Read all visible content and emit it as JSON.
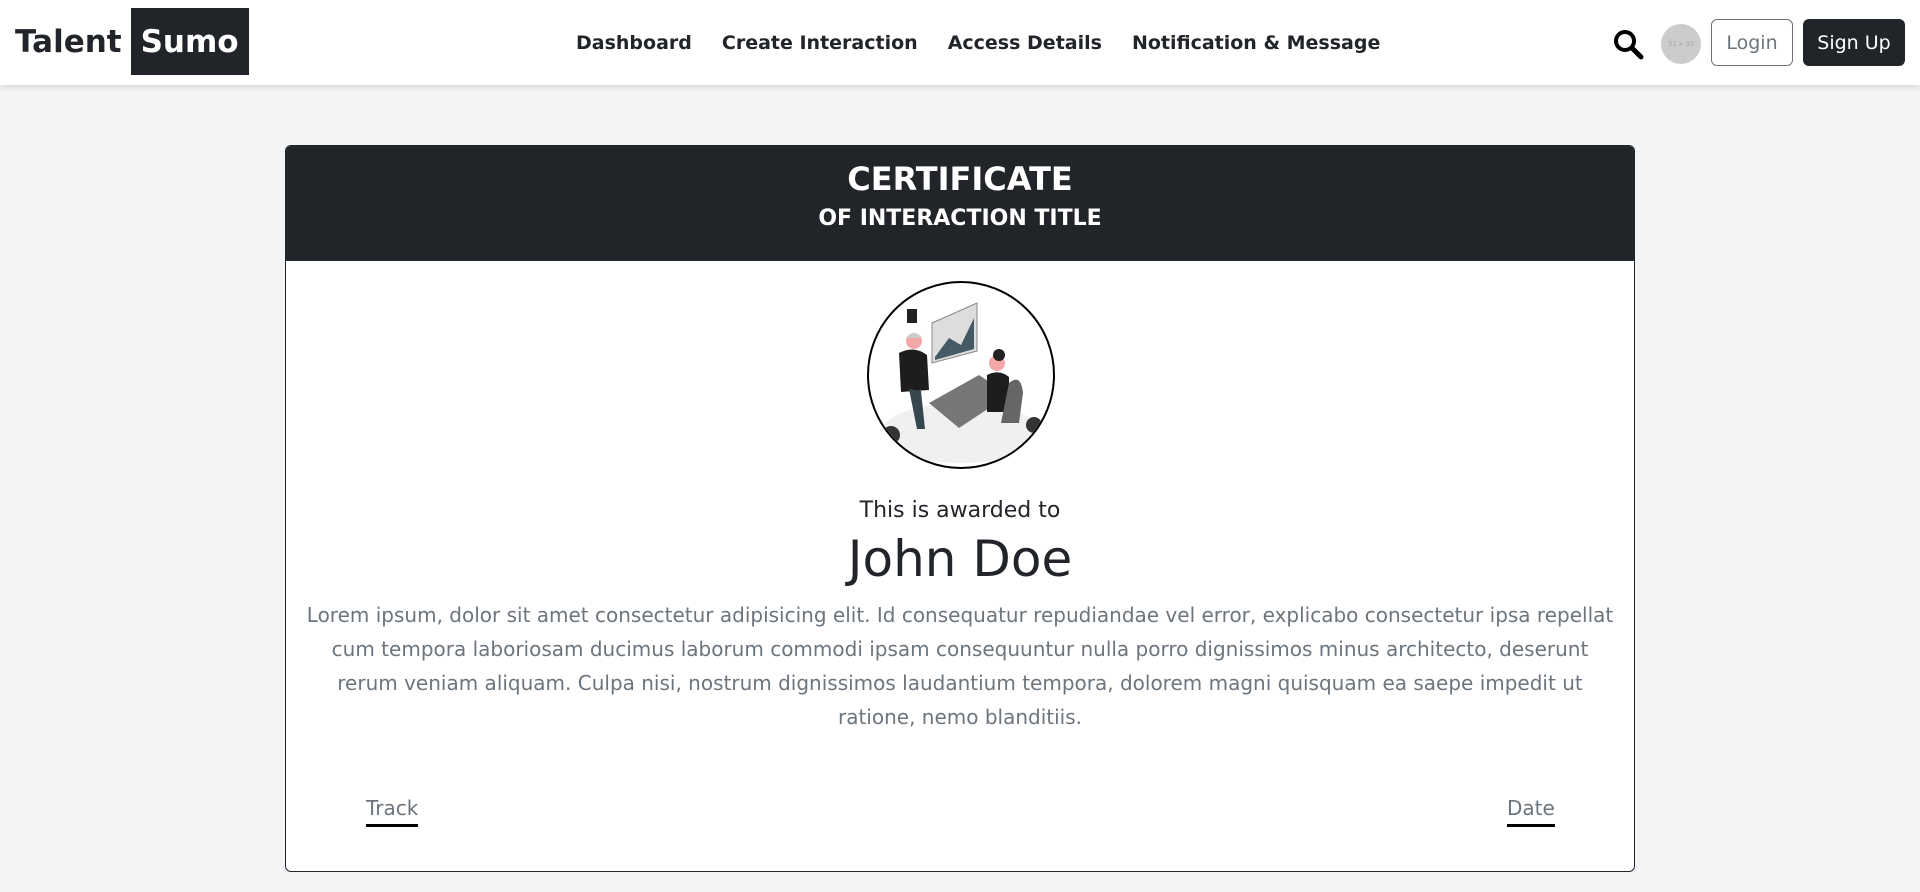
{
  "brand": {
    "part1": "Talent",
    "part2": "Sumo"
  },
  "nav": [
    "Dashboard",
    "Create Interaction",
    "Access Details",
    "Notification & Message"
  ],
  "header": {
    "avatar_text": "32 x 32",
    "login": "Login",
    "signup": "Sign Up"
  },
  "certificate": {
    "title": "CERTIFICATE",
    "subtitle": "OF INTERACTION TITLE",
    "awarded_label": "This is awarded to",
    "name": "John Doe",
    "body": "Lorem ipsum, dolor sit amet consectetur adipisicing elit. Id consequatur repudiandae vel error, explicabo consectetur ipsa repellat cum tempora laboriosam ducimus laborum commodi ipsam consequuntur nulla porro dignissimos minus architecto, deserunt rerum veniam aliquam. Culpa nisi, nostrum dignissimos laudantium tempora, dolorem magni quisquam ea saepe impedit ut ratione, nemo blanditiis.",
    "track": "Track",
    "date": "Date"
  }
}
